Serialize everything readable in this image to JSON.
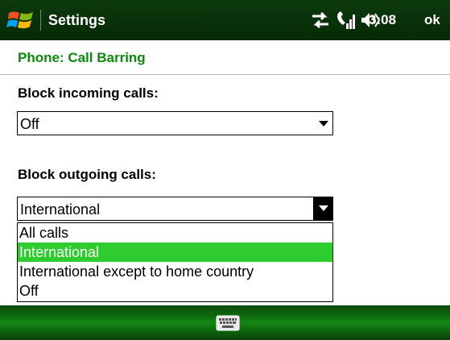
{
  "titlebar": {
    "title": "Settings",
    "clock": "3:08",
    "ok_label": "ok",
    "icons": [
      "windows-start-icon",
      "data-connection-icon",
      "signal-icon",
      "volume-icon"
    ]
  },
  "subtitle": "Phone: Call Barring",
  "incoming": {
    "label": "Block incoming calls:",
    "value": "Off"
  },
  "outgoing": {
    "label": "Block outgoing calls:",
    "value": "International",
    "options": [
      "All calls",
      "International",
      "International except to home country",
      "Off"
    ],
    "selected_index": 1
  },
  "bottombar": {
    "icon": "keyboard-icon"
  },
  "colors": {
    "titlebar": "#062a06",
    "subtitle_text": "#0a8a0a",
    "selection": "#2ecc2e",
    "bottombar": "#148814"
  }
}
